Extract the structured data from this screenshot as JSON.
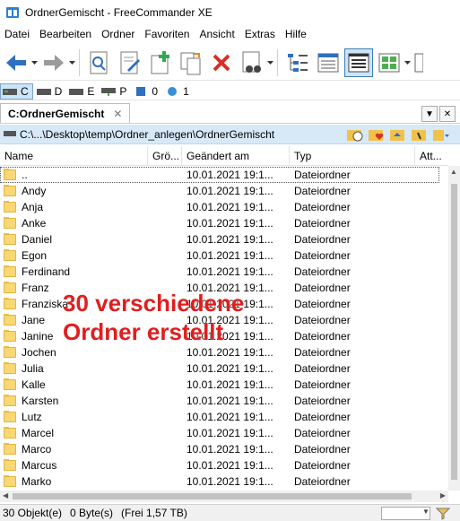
{
  "window": {
    "title": "OrdnerGemischt - FreeCommander XE"
  },
  "menu": [
    "Datei",
    "Bearbeiten",
    "Ordner",
    "Favoriten",
    "Ansicht",
    "Extras",
    "Hilfe"
  ],
  "toolbar": {
    "buttons": [
      "back-arrow-icon",
      "forward-arrow-icon",
      "find-icon",
      "edit-icon",
      "new-folder-icon",
      "copy-icon",
      "delete-icon",
      "view-binoculars-icon",
      "tree-view-icon",
      "details-view-icon",
      "list-view-icon",
      "thumbnails-view-icon"
    ]
  },
  "drives": [
    {
      "letter": "C",
      "icon": "hdd-icon"
    },
    {
      "letter": "D",
      "icon": "hdd-icon"
    },
    {
      "letter": "E",
      "icon": "hdd-icon"
    },
    {
      "letter": "P",
      "icon": "network-drive-icon"
    },
    {
      "letter": "0",
      "icon": "desktop-icon"
    },
    {
      "letter": "1",
      "icon": "network-icon"
    }
  ],
  "tab": {
    "label": "C:OrdnerGemischt",
    "close": "✕"
  },
  "tab_controls": {
    "down": "▼",
    "close": "✕"
  },
  "pathbar": {
    "path": "C:\\...\\Desktop\\temp\\Ordner_anlegen\\OrdnerGemischt"
  },
  "columns": {
    "name": "Name",
    "size": "Grö...",
    "date": "Geändert am",
    "type": "Typ",
    "attr": "Att..."
  },
  "rows": [
    {
      "name": "..",
      "date": "10.01.2021 19:1...",
      "type": "Dateiordner"
    },
    {
      "name": "Andy",
      "date": "10.01.2021 19:1...",
      "type": "Dateiordner"
    },
    {
      "name": "Anja",
      "date": "10.01.2021 19:1...",
      "type": "Dateiordner"
    },
    {
      "name": "Anke",
      "date": "10.01.2021 19:1...",
      "type": "Dateiordner"
    },
    {
      "name": "Daniel",
      "date": "10.01.2021 19:1...",
      "type": "Dateiordner"
    },
    {
      "name": "Egon",
      "date": "10.01.2021 19:1...",
      "type": "Dateiordner"
    },
    {
      "name": "Ferdinand",
      "date": "10.01.2021 19:1...",
      "type": "Dateiordner"
    },
    {
      "name": "Franz",
      "date": "10.01.2021 19:1...",
      "type": "Dateiordner"
    },
    {
      "name": "Franziska",
      "date": "10.01.2021 19:1...",
      "type": "Dateiordner"
    },
    {
      "name": "Jane",
      "date": "10.01.2021 19:1...",
      "type": "Dateiordner"
    },
    {
      "name": "Janine",
      "date": "10.01.2021 19:1...",
      "type": "Dateiordner"
    },
    {
      "name": "Jochen",
      "date": "10.01.2021 19:1...",
      "type": "Dateiordner"
    },
    {
      "name": "Julia",
      "date": "10.01.2021 19:1...",
      "type": "Dateiordner"
    },
    {
      "name": "Kalle",
      "date": "10.01.2021 19:1...",
      "type": "Dateiordner"
    },
    {
      "name": "Karsten",
      "date": "10.01.2021 19:1...",
      "type": "Dateiordner"
    },
    {
      "name": "Lutz",
      "date": "10.01.2021 19:1...",
      "type": "Dateiordner"
    },
    {
      "name": "Marcel",
      "date": "10.01.2021 19:1...",
      "type": "Dateiordner"
    },
    {
      "name": "Marco",
      "date": "10.01.2021 19:1...",
      "type": "Dateiordner"
    },
    {
      "name": "Marcus",
      "date": "10.01.2021 19:1...",
      "type": "Dateiordner"
    },
    {
      "name": "Marko",
      "date": "10.01.2021 19:1...",
      "type": "Dateiordner"
    }
  ],
  "annotation": {
    "line1": "30 verschiedene",
    "line2": "Ordner erstellt",
    "color": "#e01e1e"
  },
  "status": {
    "objects": "30 Objekt(e)",
    "bytes": "0 Byte(s)",
    "free": "(Frei 1,57 TB)"
  },
  "colors": {
    "accent": "#cce4f7",
    "path_bg": "#d7e8f7",
    "folder": "#f8d775",
    "delete": "#d93025"
  }
}
